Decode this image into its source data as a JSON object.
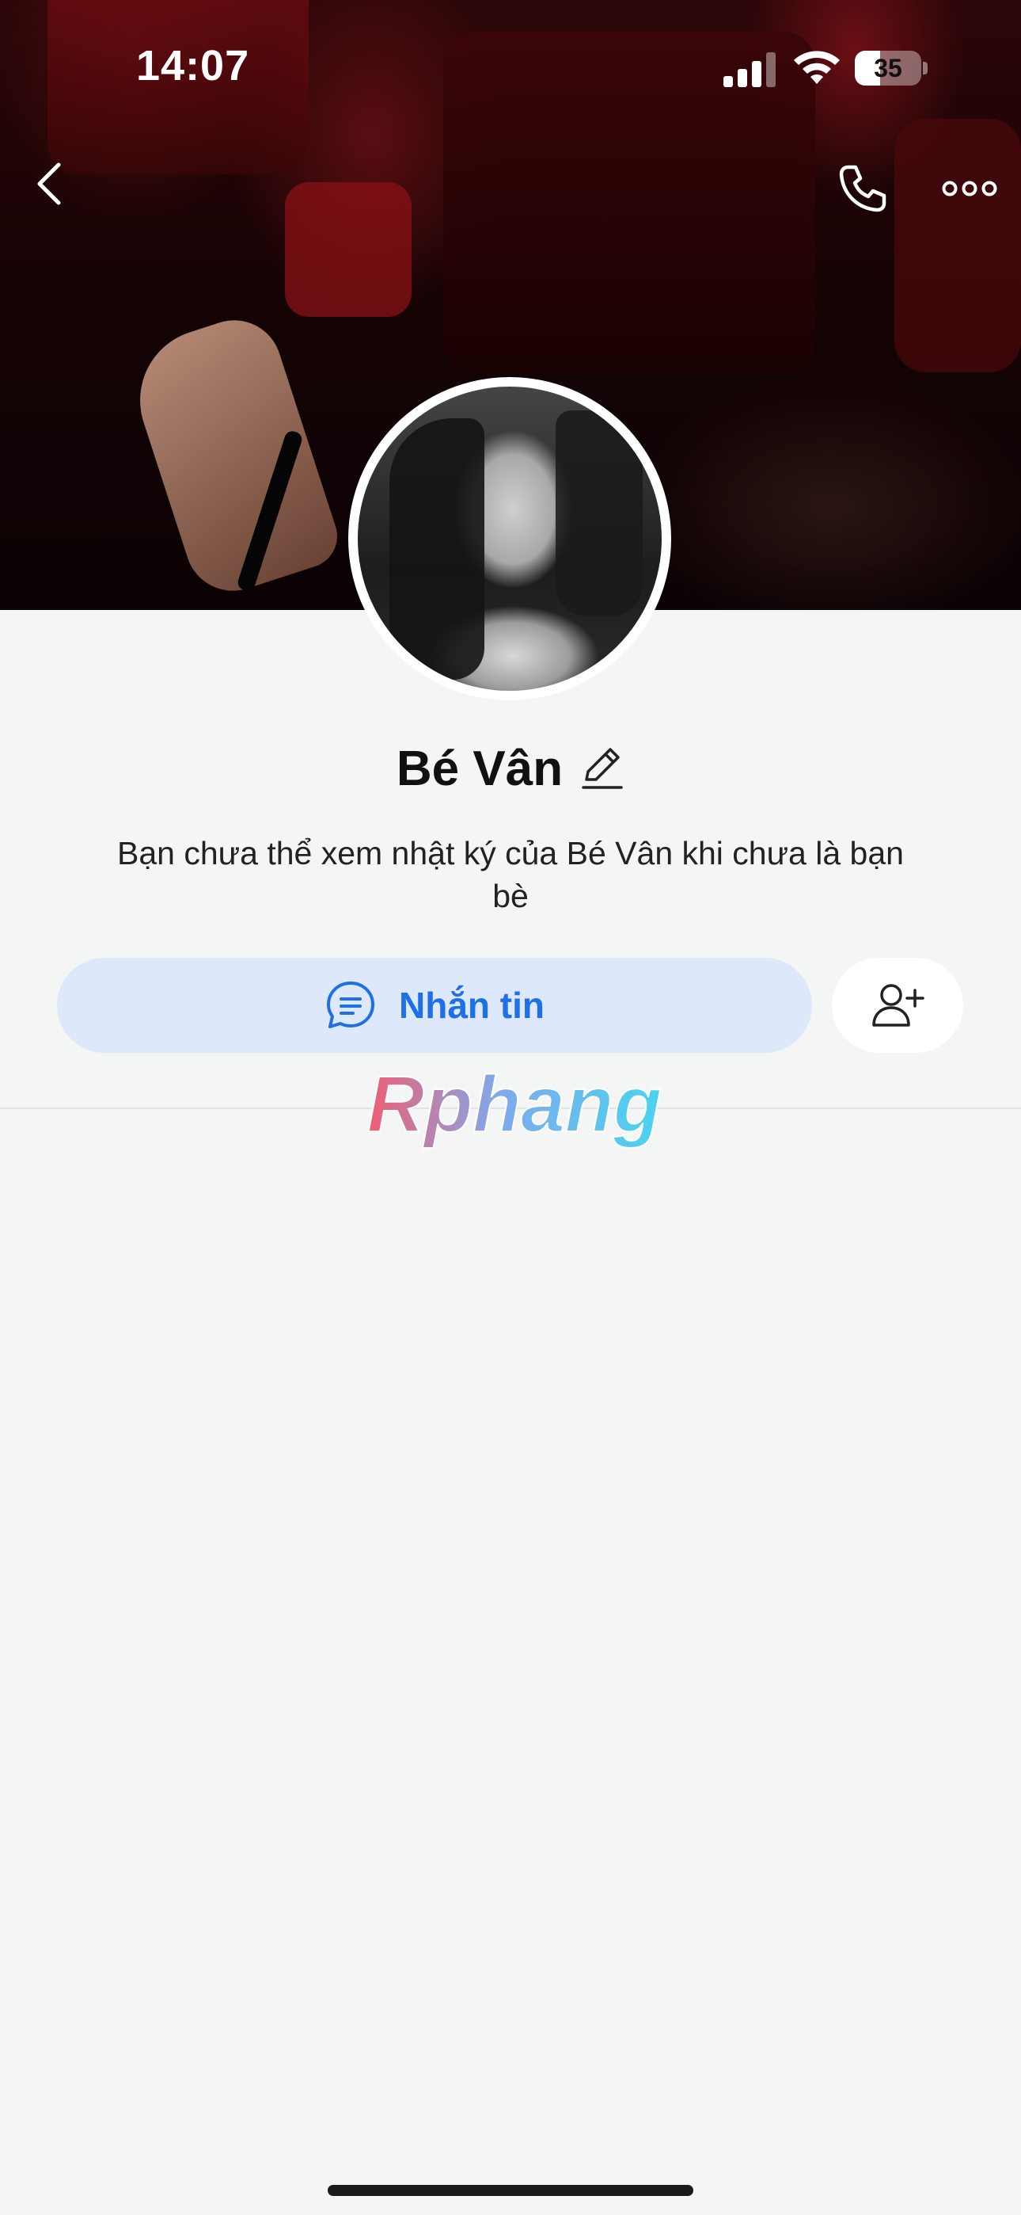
{
  "status_bar": {
    "time": "14:07",
    "battery_level": "35"
  },
  "nav": {
    "back_icon": "chevron-left-icon",
    "call_icon": "phone-icon",
    "more_icon": "ellipsis-icon"
  },
  "profile": {
    "name": "Bé Vân",
    "privacy_note": "Bạn chưa thể xem nhật ký của Bé Vân khi chưa là bạn bè"
  },
  "actions": {
    "message_label": "Nhắn tin",
    "message_icon": "chat-bubble-icon",
    "add_friend_icon": "add-friend-icon"
  },
  "watermark": {
    "text": "Rphang"
  },
  "colors": {
    "accent": "#1f6fe6",
    "message_button_bg": "#dde8fb",
    "page_bg": "#f4f5f5"
  }
}
